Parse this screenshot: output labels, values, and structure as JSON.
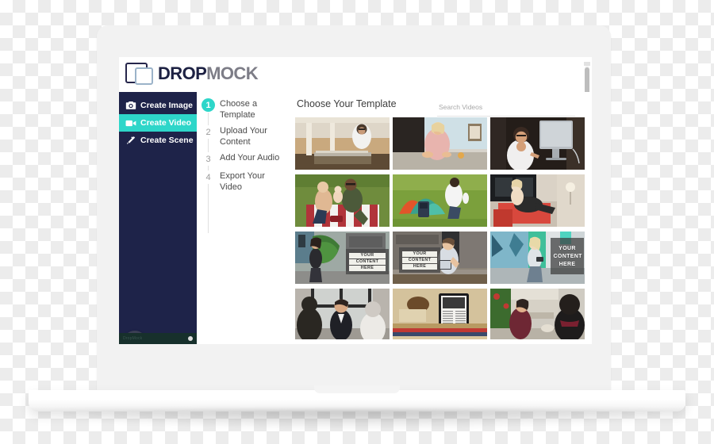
{
  "app": {
    "logo_drop": "DROP",
    "logo_mock": "MOCK"
  },
  "sidebar": {
    "items": [
      {
        "label": "Create Image",
        "icon": "camera-icon",
        "active": false
      },
      {
        "label": "Create Video",
        "icon": "video-camera-icon",
        "active": true
      },
      {
        "label": "Create Scene",
        "icon": "magic-wand-icon",
        "active": false
      }
    ],
    "chat_icon": "chat-bubble-icon",
    "footer_text": "DropMock",
    "accent_color": "#2ed6c9",
    "background_color": "#1e2349"
  },
  "steps": {
    "items": [
      {
        "number": "1",
        "label": "Choose a Template",
        "active": true
      },
      {
        "number": "2",
        "label": "Upload Your Content",
        "active": false
      },
      {
        "number": "3",
        "label": "Add Your Audio",
        "active": false
      },
      {
        "number": "4",
        "label": "Export Your Video",
        "active": false
      }
    ]
  },
  "main": {
    "title": "Choose Your Template",
    "search_placeholder": "Search Videos",
    "search_value": "",
    "templates": [
      {
        "id": "t1",
        "caption": "Woman presenting at hotel reception desk"
      },
      {
        "id": "t2",
        "caption": "Blonde woman typing at a cafe table"
      },
      {
        "id": "t3",
        "caption": "Woman working at an iMac desktop"
      },
      {
        "id": "t4",
        "caption": "Family picnic on a red striped blanket"
      },
      {
        "id": "t5",
        "caption": "Man pitching a camping tent on grass"
      },
      {
        "id": "t6",
        "caption": "Woman relaxing on a red lounge chair"
      },
      {
        "id": "t7",
        "caption": "Woman walking past a wall sign",
        "overlay": [
          "YOUR",
          "CONTENT",
          "HERE"
        ]
      },
      {
        "id": "t8",
        "caption": "Man with tablet beside a street poster",
        "overlay": [
          "YOUR",
          "CONTENT",
          "HERE"
        ]
      },
      {
        "id": "t9",
        "caption": "Woman on phone beside a mural poster",
        "overlay": [
          "YOUR",
          "CONTENT",
          "HERE"
        ]
      },
      {
        "id": "t10",
        "caption": "Business people talking by a window"
      },
      {
        "id": "t11",
        "caption": "Tablet propped on a stack of books"
      },
      {
        "id": "t12",
        "caption": "Two people chatting in a cafe"
      }
    ]
  }
}
